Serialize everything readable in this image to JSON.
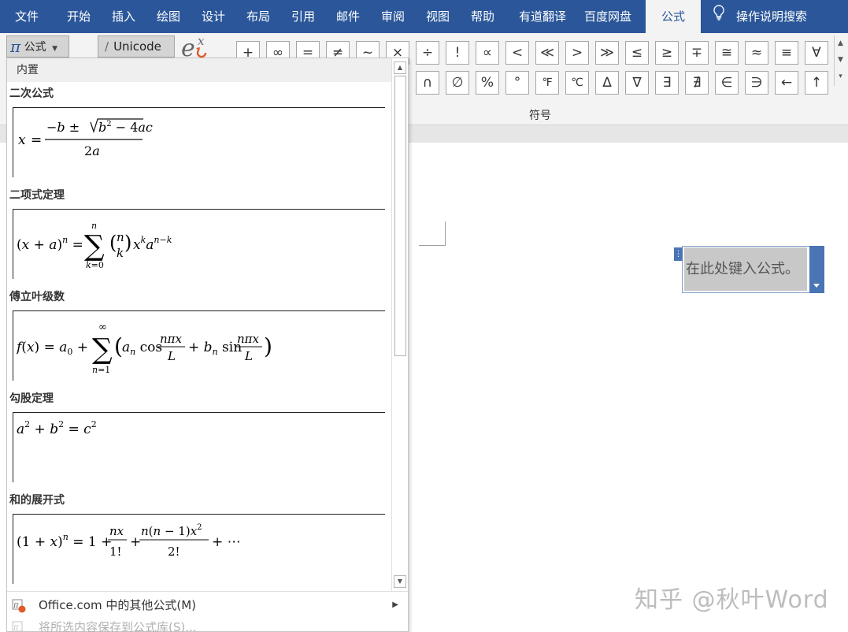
{
  "ribbon": {
    "tabs": [
      {
        "label": "文件",
        "active": false
      },
      {
        "label": "开始",
        "active": false
      },
      {
        "label": "插入",
        "active": false
      },
      {
        "label": "绘图",
        "active": false
      },
      {
        "label": "设计",
        "active": false
      },
      {
        "label": "布局",
        "active": false
      },
      {
        "label": "引用",
        "active": false
      },
      {
        "label": "邮件",
        "active": false
      },
      {
        "label": "审阅",
        "active": false
      },
      {
        "label": "视图",
        "active": false
      },
      {
        "label": "帮助",
        "active": false
      },
      {
        "label": "有道翻译",
        "active": false
      },
      {
        "label": "百度网盘",
        "active": false
      },
      {
        "label": "公式",
        "active": true
      }
    ],
    "tell_me": "操作说明搜索",
    "equation_button": "公式",
    "unicode_button": "Unicode",
    "symbols_row1": [
      "+",
      "∞",
      "=",
      "≠",
      "~",
      "×",
      "÷",
      "!",
      "∝",
      "<",
      "≪",
      ">",
      "≫",
      "≤",
      "≥",
      "∓",
      "≅",
      "≈",
      "≡",
      "∀"
    ],
    "symbols_row2": [
      "∩",
      "∅",
      "%",
      "°",
      "℉",
      "℃",
      "∆",
      "∇",
      "∃",
      "∄",
      "∈",
      "∋",
      "←",
      "↑"
    ],
    "group_label": "符号",
    "accent_color": "#2b579a"
  },
  "gallery": {
    "header": "内置",
    "items": [
      {
        "title": "二次公式"
      },
      {
        "title": "二项式定理"
      },
      {
        "title": "傅立叶级数"
      },
      {
        "title": "勾股定理"
      },
      {
        "title": "和的展开式"
      }
    ],
    "footer": {
      "more": "Office.com 中的其他公式(M)",
      "save": "将所选内容保存到公式库(S)..."
    }
  },
  "document": {
    "placeholder": "在此处键入公式。"
  },
  "watermark": "知乎 @秋叶Word"
}
